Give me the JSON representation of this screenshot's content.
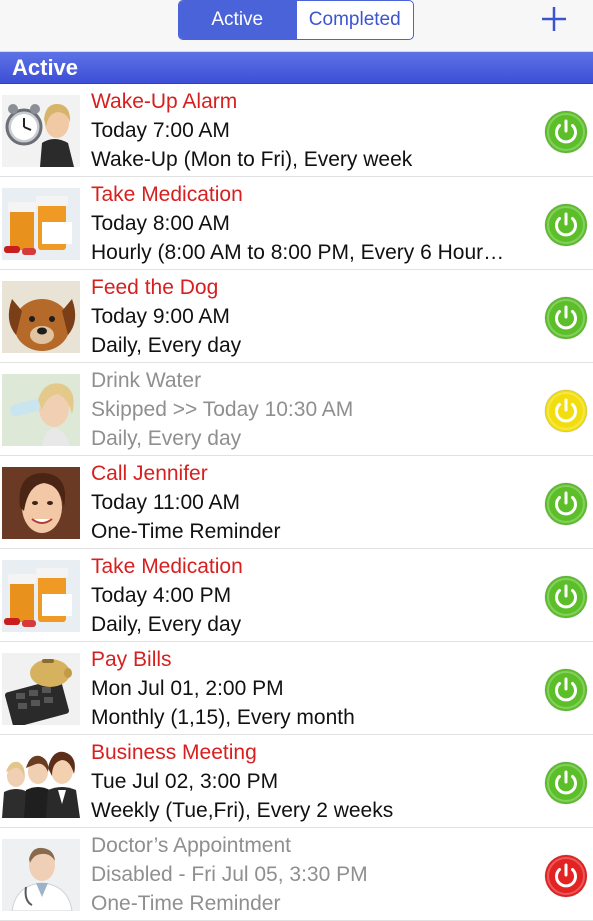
{
  "header": {
    "segments": [
      {
        "label": "Active",
        "selected": true
      },
      {
        "label": "Completed",
        "selected": false
      }
    ],
    "add_icon": "plus-icon",
    "accent_color": "#4a63d8"
  },
  "section": {
    "title": "Active"
  },
  "colors": {
    "title_red": "#d81f1f",
    "power_green": "#5cbf2a",
    "power_yellow": "#f2de0e",
    "power_red": "#e32222",
    "dim_gray": "#8f8f8f"
  },
  "reminders": [
    {
      "title": "Wake-Up Alarm",
      "time": "Today 7:00 AM",
      "repeat": "Wake-Up (Mon to Fri), Every week",
      "status": "on",
      "dim": false,
      "image": "woman-with-alarm-clock"
    },
    {
      "title": "Take Medication",
      "time": "Today 8:00 AM",
      "repeat": "Hourly (8:00 AM to 8:00 PM, Every 6 Hour…",
      "status": "on",
      "dim": false,
      "image": "medication-bottles"
    },
    {
      "title": "Feed the Dog",
      "time": "Today 9:00 AM",
      "repeat": "Daily, Every day",
      "status": "on",
      "dim": false,
      "image": "dog"
    },
    {
      "title": "Drink Water",
      "time": "Skipped >> Today 10:30 AM",
      "repeat": "Daily, Every day",
      "status": "skipped",
      "dim": true,
      "image": "woman-drinking-water"
    },
    {
      "title": "Call Jennifer",
      "time": "Today 11:00 AM",
      "repeat": "One-Time Reminder",
      "status": "on",
      "dim": false,
      "image": "smiling-woman"
    },
    {
      "title": "Take Medication",
      "time": "Today 4:00 PM",
      "repeat": "Daily, Every day",
      "status": "on",
      "dim": false,
      "image": "medication-bottles"
    },
    {
      "title": "Pay Bills",
      "time": "Mon Jul 01, 2:00 PM",
      "repeat": "Monthly (1,15), Every month",
      "status": "on",
      "dim": false,
      "image": "piggy-bank-calculator"
    },
    {
      "title": "Business Meeting",
      "time": "Tue Jul 02, 3:00 PM",
      "repeat": "Weekly (Tue,Fri), Every 2 weeks",
      "status": "on",
      "dim": false,
      "image": "business-people"
    },
    {
      "title": "Doctor’s Appointment",
      "time": "Disabled - Fri Jul 05, 3:30 PM",
      "repeat": "One-Time Reminder",
      "status": "disabled",
      "dim": true,
      "image": "doctor"
    }
  ]
}
